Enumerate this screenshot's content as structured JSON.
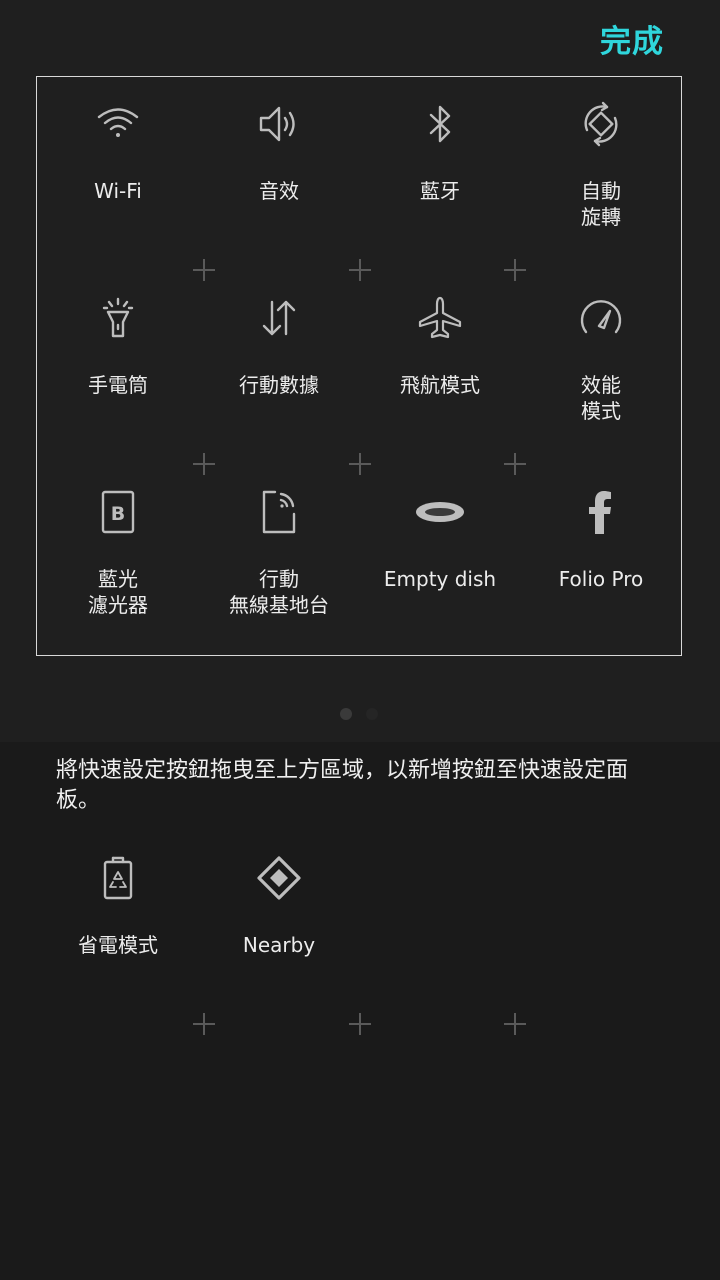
{
  "header": {
    "done_label": "完成"
  },
  "active_tiles": [
    {
      "label": "Wi-Fi",
      "icon": "wifi-icon"
    },
    {
      "label": "音效",
      "icon": "speaker-icon"
    },
    {
      "label": "藍牙",
      "icon": "bluetooth-icon"
    },
    {
      "label": "自動\n旋轉",
      "icon": "auto-rotate-icon"
    },
    {
      "label": "手電筒",
      "icon": "flashlight-icon"
    },
    {
      "label": "行動數據",
      "icon": "mobile-data-icon"
    },
    {
      "label": "飛航模式",
      "icon": "airplane-icon"
    },
    {
      "label": "效能\n模式",
      "icon": "performance-gauge-icon"
    },
    {
      "label": "藍光\n濾光器",
      "icon": "blue-light-filter-icon"
    },
    {
      "label": "行動\n無線基地台",
      "icon": "mobile-hotspot-icon"
    },
    {
      "label": "Empty dish",
      "icon": "empty-dish-icon"
    },
    {
      "label": "Folio Pro",
      "icon": "facebook-f-icon"
    }
  ],
  "pagination": {
    "current_page": 1,
    "total_pages": 2
  },
  "instruction_text": "將快速設定按鈕拖曳至上方區域，以新增按鈕至快速設定面板。",
  "available_tiles": [
    {
      "label": "省電模式",
      "icon": "battery-saver-icon"
    },
    {
      "label": "Nearby",
      "icon": "nearby-icon"
    }
  ],
  "colors": {
    "accent": "#2fd6dc",
    "background_top": "#1f1f1f",
    "background_bottom": "#1a1a1a",
    "icon": "#bdbdbd"
  }
}
